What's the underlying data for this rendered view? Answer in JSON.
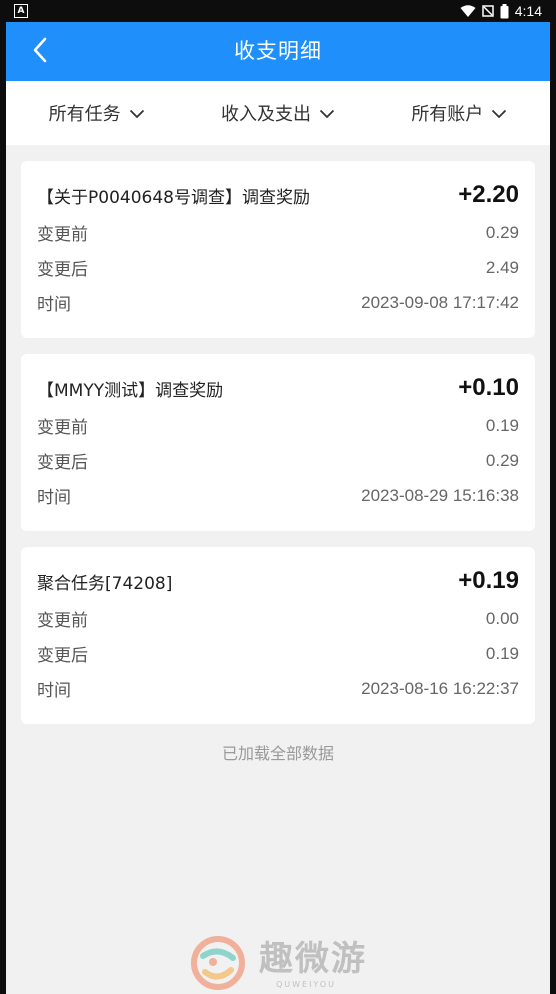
{
  "status_bar": {
    "left_badge": "A",
    "time": "4:14"
  },
  "header": {
    "title": "收支明细"
  },
  "filters": [
    {
      "label": "所有任务"
    },
    {
      "label": "收入及支出"
    },
    {
      "label": "所有账户"
    }
  ],
  "records": [
    {
      "title": "【关于P0040648号调查】调查奖励",
      "amount": "+2.20",
      "rows": [
        {
          "label": "变更前",
          "value": "0.29"
        },
        {
          "label": "变更后",
          "value": "2.49"
        },
        {
          "label": "时间",
          "value": "2023-09-08 17:17:42"
        }
      ]
    },
    {
      "title": "【MMYY测试】调查奖励",
      "amount": "+0.10",
      "rows": [
        {
          "label": "变更前",
          "value": "0.19"
        },
        {
          "label": "变更后",
          "value": "0.29"
        },
        {
          "label": "时间",
          "value": "2023-08-29 15:16:38"
        }
      ]
    },
    {
      "title": "聚合任务[74208]",
      "amount": "+0.19",
      "rows": [
        {
          "label": "变更前",
          "value": "0.00"
        },
        {
          "label": "变更后",
          "value": "0.19"
        },
        {
          "label": "时间",
          "value": "2023-08-16 16:22:37"
        }
      ]
    }
  ],
  "footer": {
    "note": "已加载全部数据"
  },
  "watermark": {
    "text": "趣微游",
    "sub": "QUWEIYOU"
  },
  "colors": {
    "primary": "#1e8ffb",
    "background": "#f1f1f1"
  },
  "icons": {
    "back": "chevron-left-icon",
    "filter": "chevron-down-icon",
    "wifi": "wifi-icon",
    "battery": "battery-icon"
  }
}
